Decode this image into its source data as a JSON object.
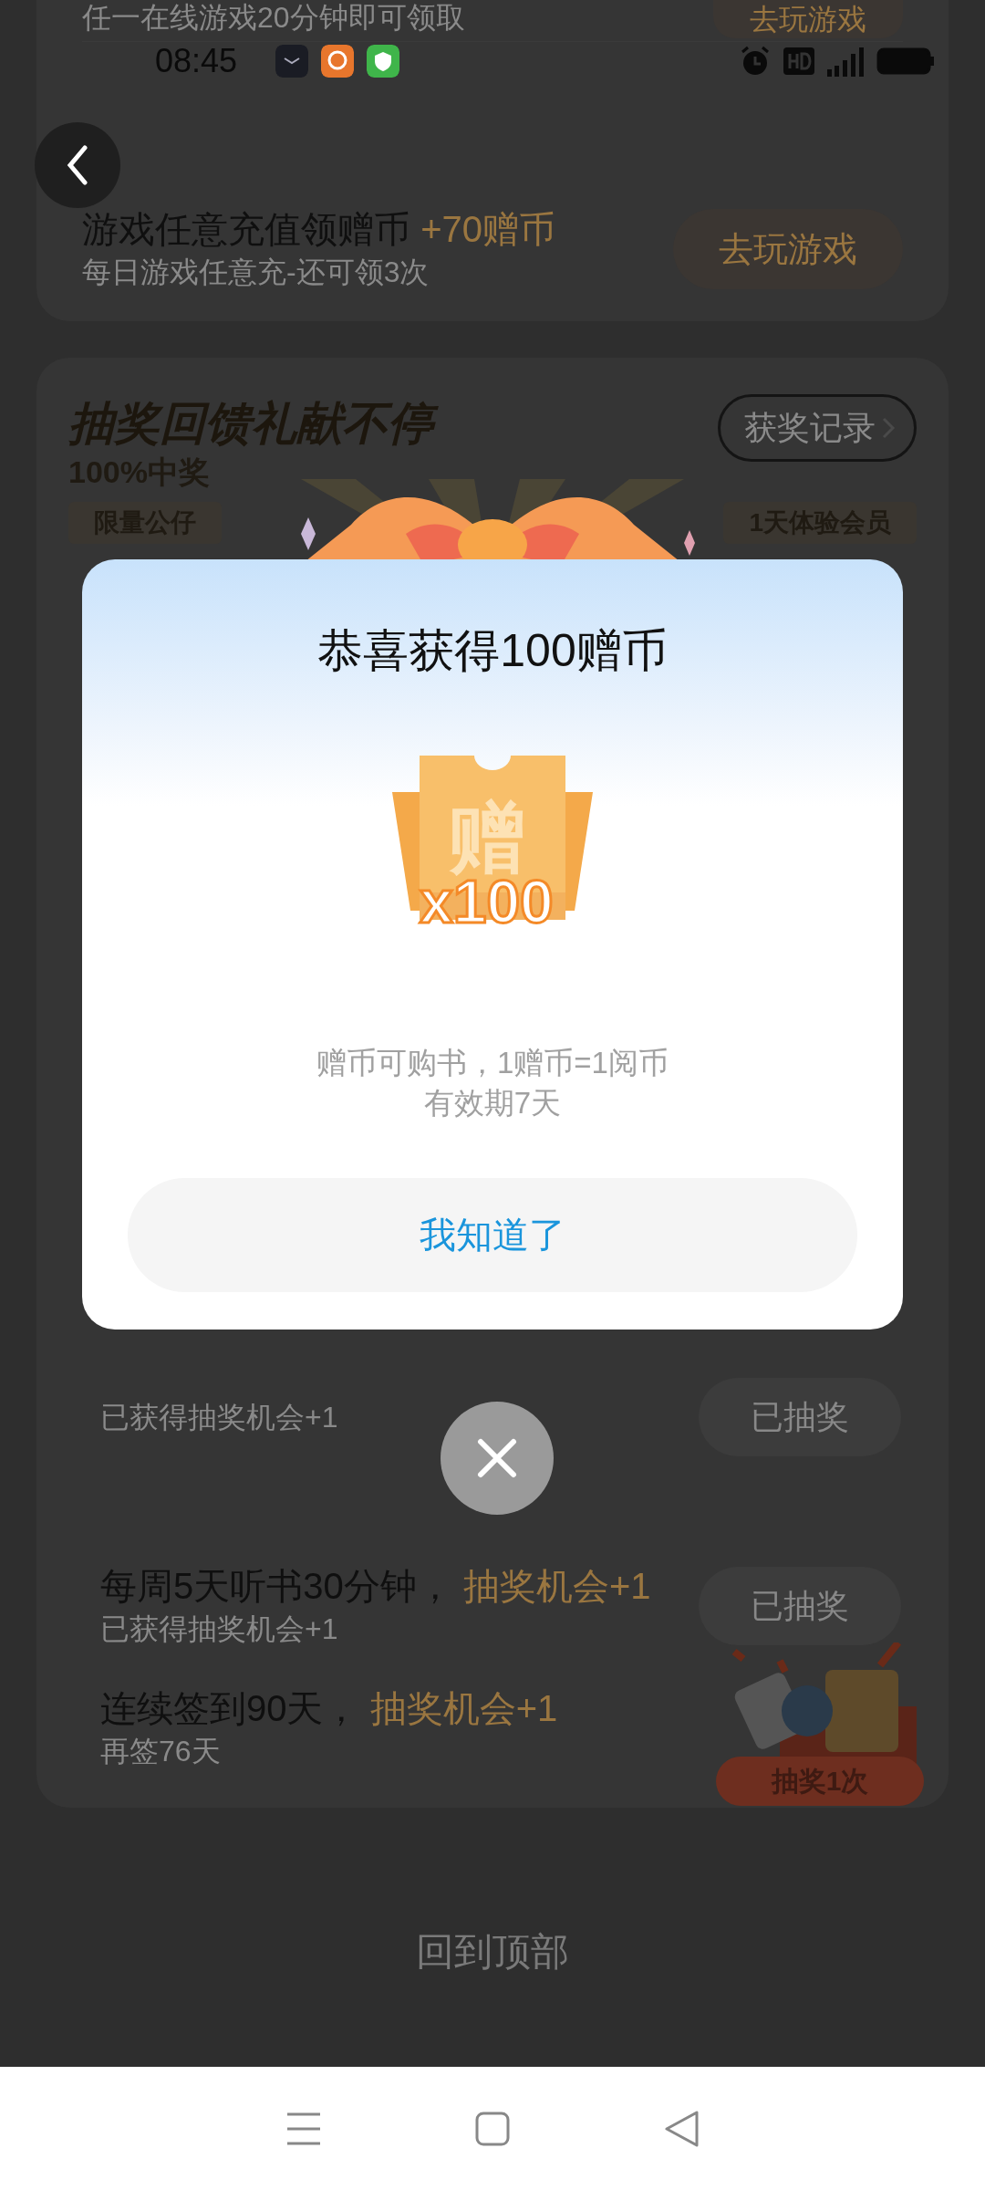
{
  "status_bar": {
    "time": "08:45"
  },
  "game_tasks": [
    {
      "subtitle": "任一在线游戏20分钟即可领取",
      "button": "去玩游戏"
    },
    {
      "title": "游戏任意充值领赠币",
      "reward": "+70赠币",
      "subtitle": "每日游戏任意充-还可领3次",
      "button": "去玩游戏"
    }
  ],
  "lottery": {
    "title": "抽奖回馈礼献不停",
    "subtitle": "100%中奖",
    "records_button": "获奖记录",
    "prizes": [
      "限量公仔",
      "1天体验会员"
    ],
    "tasks": [
      {
        "subtitle": "已获得抽奖机会+1",
        "button": "已抽奖"
      },
      {
        "title": "每周5天听书30分钟，",
        "reward": "抽奖机会+1",
        "subtitle": "已获得抽奖机会+1",
        "button": "已抽奖"
      },
      {
        "title": "连续签到90天，",
        "reward": "抽奖机会+1",
        "subtitle": "再签76天"
      }
    ]
  },
  "back_to_top": "回到顶部",
  "floating_gift": {
    "label": "抽奖1次"
  },
  "dialog": {
    "title": "恭喜获得100赠币",
    "ticket_char": "赠",
    "ticket_amount": "x100",
    "description": [
      "赠币可购书，1赠币=1阅币",
      "有效期7天"
    ],
    "button": "我知道了"
  }
}
